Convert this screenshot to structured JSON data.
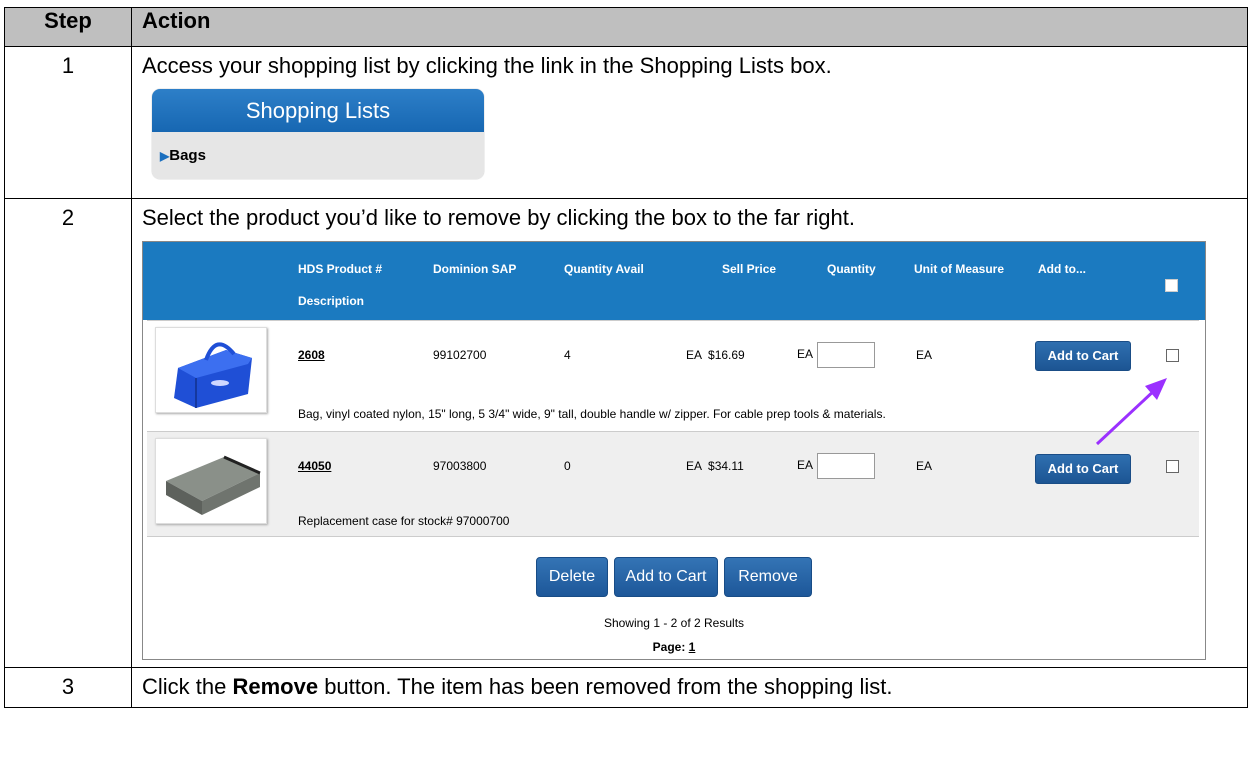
{
  "headers": {
    "step": "Step",
    "action": "Action"
  },
  "steps": [
    {
      "num": "1",
      "text": "Access your shopping list by clicking the link in the Shopping Lists box."
    },
    {
      "num": "2",
      "text": "Select the product you’d like to remove by clicking the box to the far right."
    },
    {
      "num": "3",
      "text_pre": "Click the ",
      "text_bold": "Remove",
      "text_post": " button. The item has been removed from the shopping list."
    }
  ],
  "shopping_lists": {
    "title": "Shopping Lists",
    "item": "Bags"
  },
  "product_table": {
    "columns": {
      "hds": "HDS Product #",
      "description": "Description",
      "sap": "Dominion SAP",
      "qty_avail": "Quantity Avail",
      "price": "Sell Price",
      "quantity": "Quantity",
      "uom": "Unit of Measure",
      "add_to": "Add to..."
    },
    "rows": [
      {
        "hds": "2608",
        "sap": "99102700",
        "qty_avail": "4",
        "price": "EA  $16.69",
        "qty_unit": "EA",
        "uom": "EA",
        "add_label": "Add to Cart",
        "description": "Bag, vinyl coated nylon, 15\" long, 5 3/4\" wide, 9\" tall, double handle w/ zipper. For cable prep tools & materials."
      },
      {
        "hds": "44050",
        "sap": "97003800",
        "qty_avail": "0",
        "price": "EA  $34.11",
        "qty_unit": "EA",
        "uom": "EA",
        "add_label": "Add to Cart",
        "description": "Replacement case for stock# 97000700"
      }
    ],
    "buttons": {
      "delete": "Delete",
      "add_to_cart": "Add to Cart",
      "remove": "Remove"
    },
    "results": "Showing 1 - 2 of 2 Results",
    "page_label": "Page:",
    "page_num": "1"
  },
  "colors": {
    "header_blue": "#1b7ac0",
    "button_blue": "#1d5799",
    "arrow_purple": "#9b30ff"
  }
}
